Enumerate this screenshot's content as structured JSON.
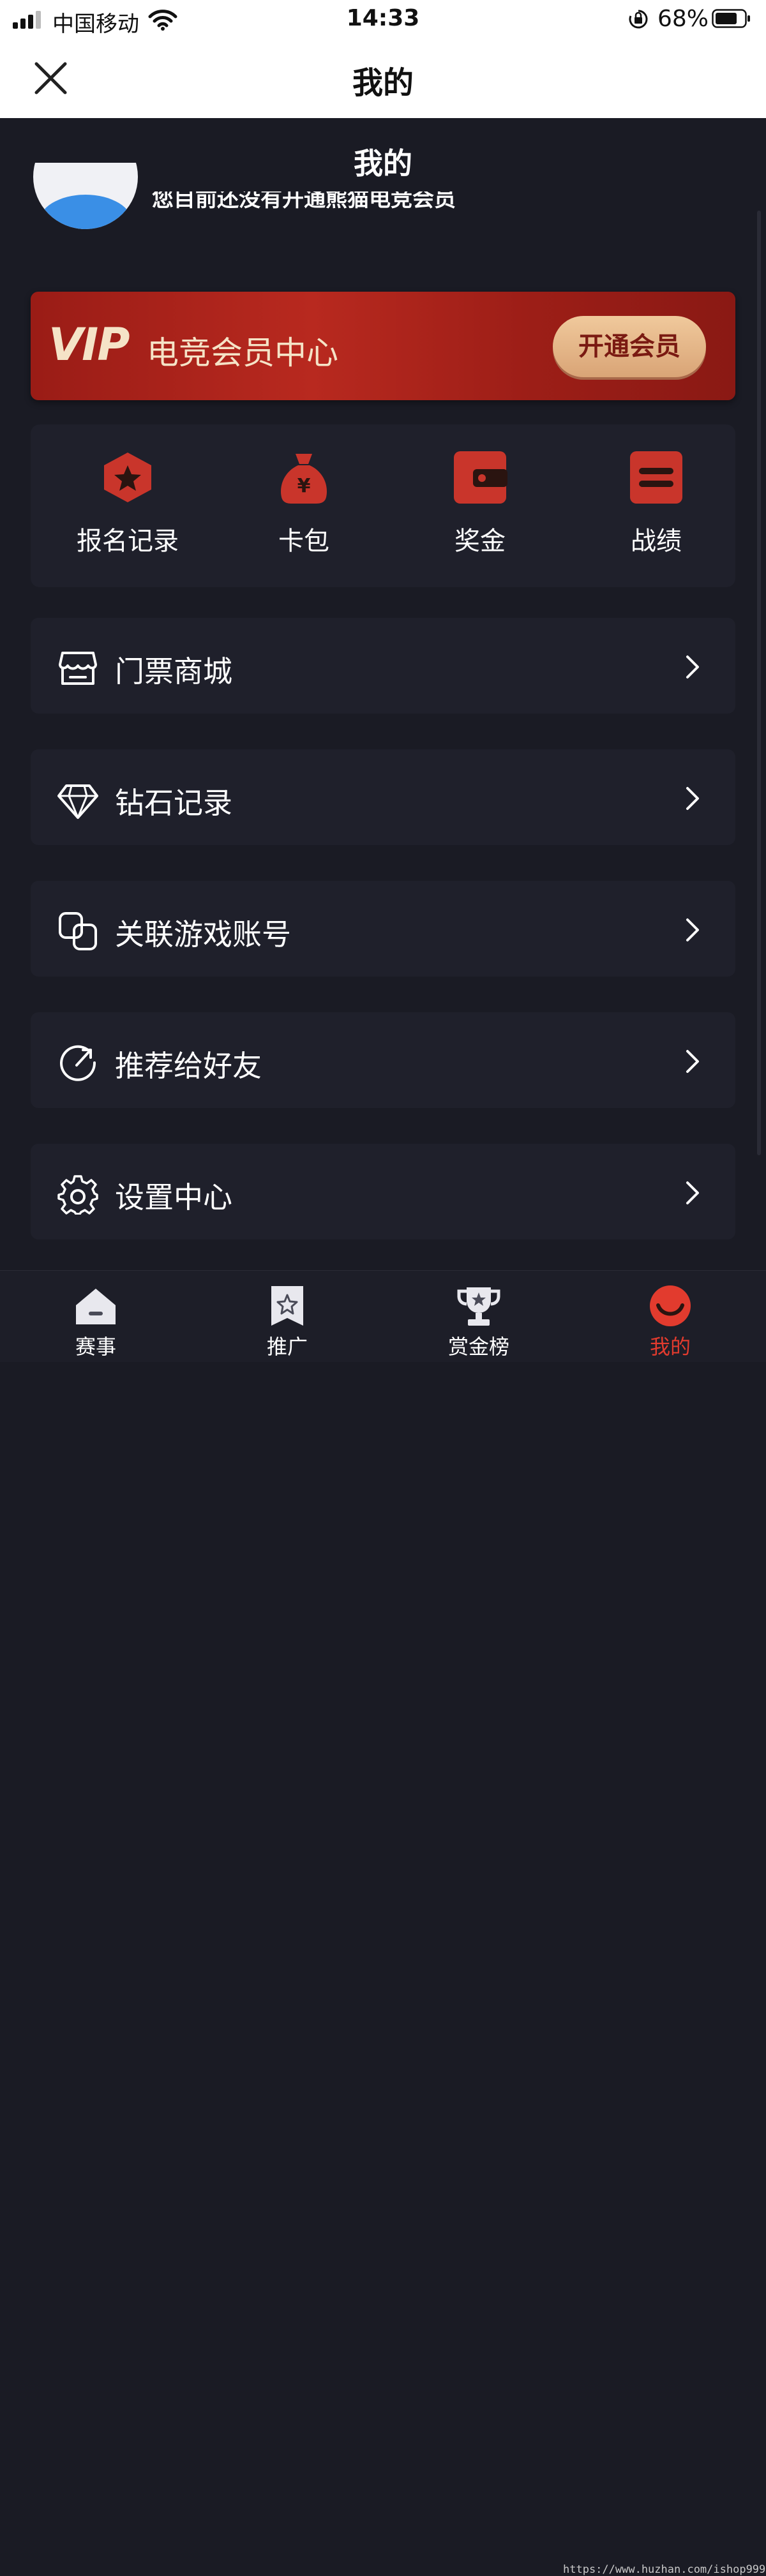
{
  "status_bar": {
    "carrier": "中国移动",
    "time": "14:33",
    "battery": "68%"
  },
  "header": {
    "title": "我的"
  },
  "page": {
    "title": "我的"
  },
  "profile": {
    "member_note": "您目前还没有开通熊猫电竞会员"
  },
  "vip": {
    "badge": "VIP",
    "title": "电竞会员中心",
    "open_button": "开通会员"
  },
  "quick_actions": [
    {
      "label": "报名记录",
      "icon": "star-badge-icon"
    },
    {
      "label": "卡包",
      "icon": "money-bag-icon"
    },
    {
      "label": "奖金",
      "icon": "wallet-icon"
    },
    {
      "label": "战绩",
      "icon": "record-icon"
    }
  ],
  "menu": [
    {
      "label": "门票商城",
      "icon": "store-icon"
    },
    {
      "label": "钻石记录",
      "icon": "diamond-icon"
    },
    {
      "label": "关联游戏账号",
      "icon": "link-icon"
    },
    {
      "label": "推荐给好友",
      "icon": "share-icon"
    },
    {
      "label": "设置中心",
      "icon": "gear-icon"
    }
  ],
  "tabs": [
    {
      "label": "赛事",
      "icon": "home-icon",
      "active": false
    },
    {
      "label": "推广",
      "icon": "bookmark-star-icon",
      "active": false
    },
    {
      "label": "赏金榜",
      "icon": "trophy-icon",
      "active": false
    },
    {
      "label": "我的",
      "icon": "smile-icon",
      "active": true
    }
  ],
  "watermark": "https://www.huzhan.com/ishop999",
  "colors": {
    "accent": "#e23b2e",
    "background": "#1a1b24",
    "card": "#1f202b",
    "vip_gold": "#f5e3c7"
  }
}
